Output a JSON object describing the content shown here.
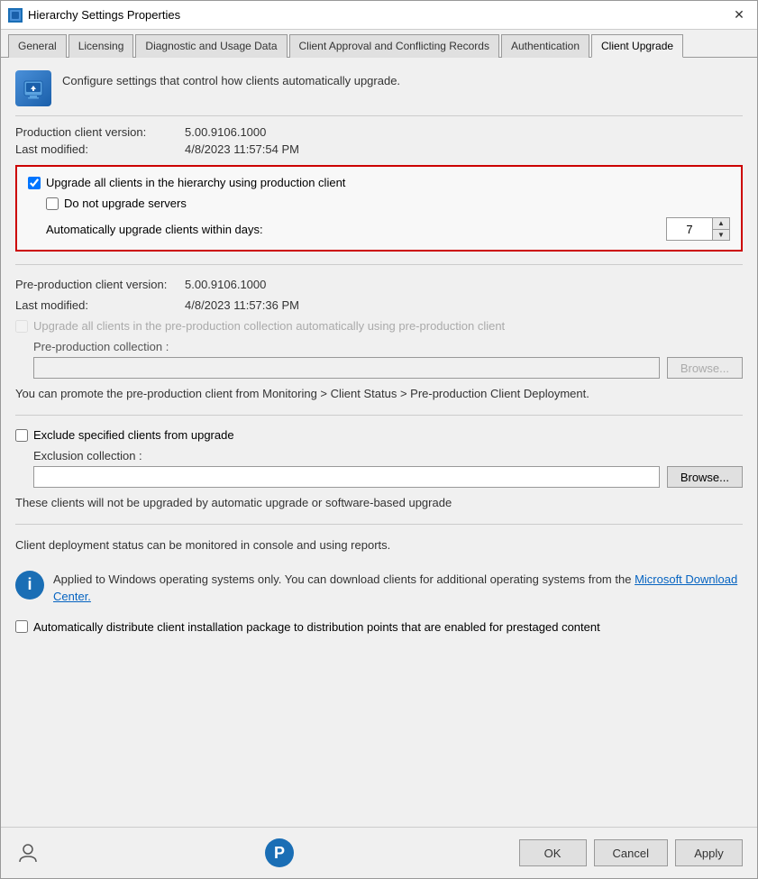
{
  "window": {
    "title": "Hierarchy Settings Properties",
    "icon": "settings-icon"
  },
  "tabs": [
    {
      "id": "general",
      "label": "General"
    },
    {
      "id": "licensing",
      "label": "Licensing"
    },
    {
      "id": "diagnostic",
      "label": "Diagnostic and Usage Data"
    },
    {
      "id": "client-approval",
      "label": "Client Approval and Conflicting Records"
    },
    {
      "id": "authentication",
      "label": "Authentication"
    },
    {
      "id": "client-upgrade",
      "label": "Client Upgrade",
      "active": true
    }
  ],
  "header": {
    "description": "Configure settings that control how clients automatically upgrade."
  },
  "production": {
    "version_label": "Production client version:",
    "version_value": "5.00.9106.1000",
    "modified_label": "Last modified:",
    "modified_value": "4/8/2023 11:57:54 PM"
  },
  "upgrade_section": {
    "upgrade_all_label": "Upgrade all clients in the hierarchy using production client",
    "upgrade_all_checked": true,
    "do_not_upgrade_label": "Do not upgrade servers",
    "do_not_upgrade_checked": false,
    "auto_upgrade_label": "Automatically upgrade clients within days:",
    "auto_upgrade_days": "7"
  },
  "preproduction": {
    "version_label": "Pre-production client version:",
    "version_value": "5.00.9106.1000",
    "modified_label": "Last modified:",
    "modified_value": "4/8/2023 11:57:36 PM",
    "upgrade_label": "Upgrade all clients in the pre-production collection automatically using pre-production client",
    "upgrade_checked": false,
    "collection_label": "Pre-production collection :",
    "collection_placeholder": "",
    "browse_label": "Browse...",
    "hint": "You can promote the pre-production client from Monitoring > Client Status > Pre-production Client Deployment."
  },
  "exclusion": {
    "exclude_label": "Exclude specified clients from upgrade",
    "exclude_checked": false,
    "collection_label": "Exclusion collection :",
    "collection_placeholder": "",
    "browse_label": "Browse...",
    "hint": "These clients will not be upgraded by automatic upgrade or software-based upgrade"
  },
  "deployment": {
    "status_hint": "Client deployment status can be monitored in console and using reports.",
    "info_text": "Applied to Windows operating systems only. You can download clients for additional operating systems from the ",
    "link_text": "Microsoft Download Center.",
    "auto_distribute_label": "Automatically distribute client installation package to distribution points that are enabled for prestaged content",
    "auto_distribute_checked": false
  },
  "footer": {
    "ok_label": "OK",
    "cancel_label": "Cancel",
    "apply_label": "Apply"
  }
}
